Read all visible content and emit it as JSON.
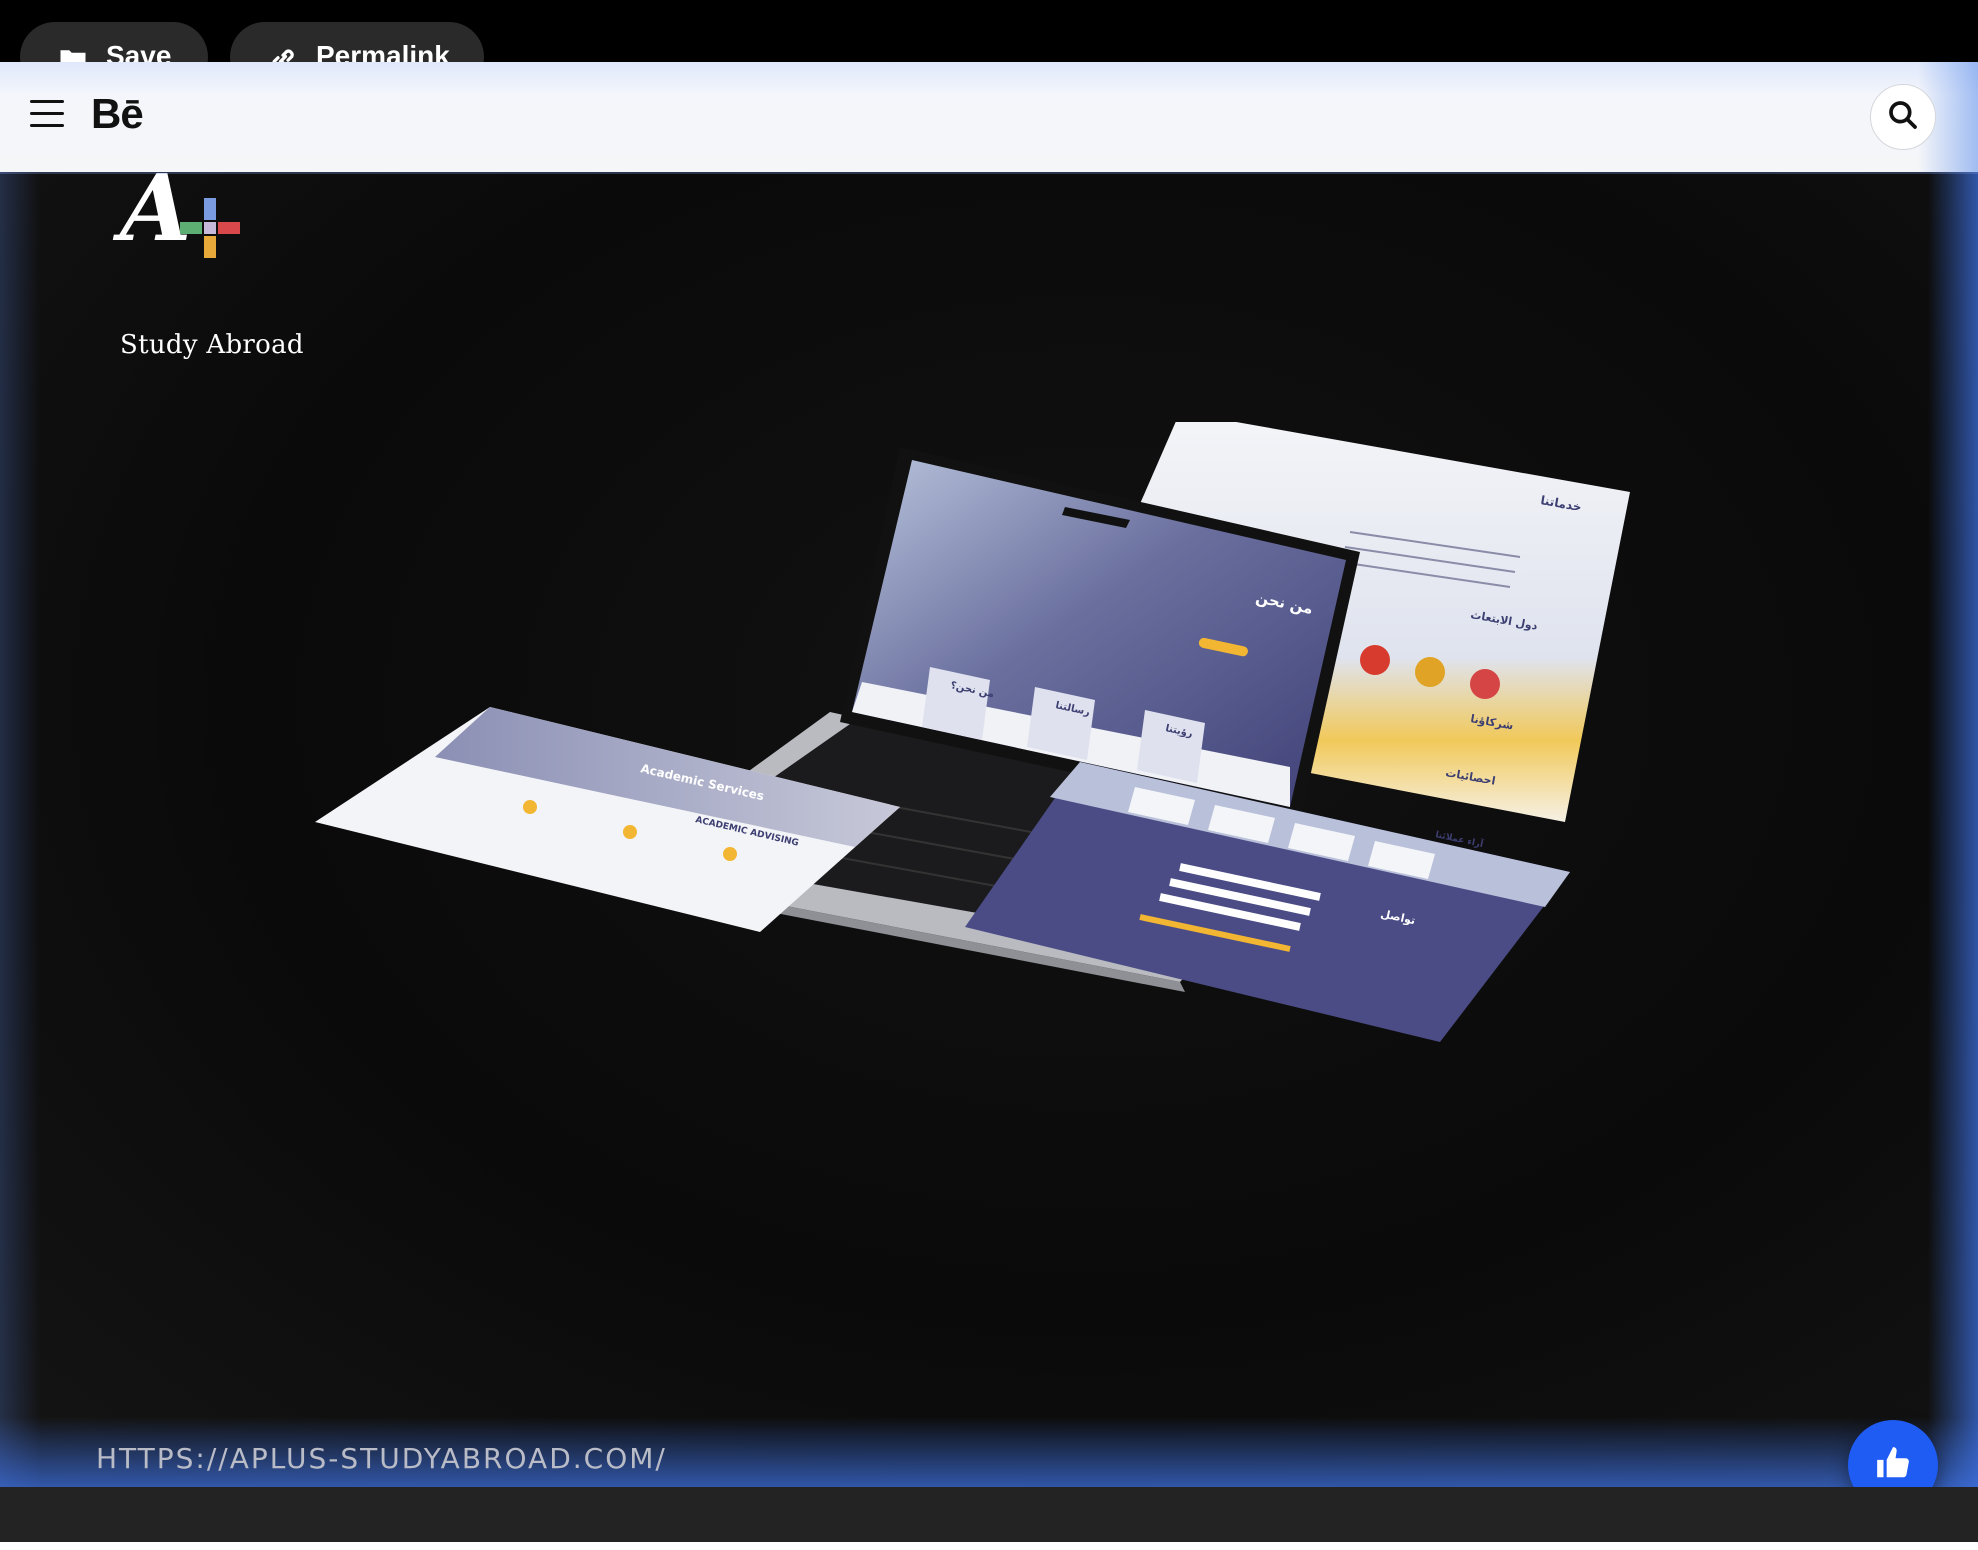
{
  "toolbar": {
    "save_label": "Save",
    "permalink_label": "Permalink",
    "save_icon": "folder-icon",
    "permalink_icon": "link-icon"
  },
  "header": {
    "brand": "Bē",
    "menu_icon": "hamburger-menu-icon",
    "search_icon": "search-icon"
  },
  "project": {
    "logo_text": "Study Abroad",
    "website_url": "HTTPS://APLUS-STUDYABROAD.COM/",
    "mockup": {
      "hero_heading": "من نحن",
      "cards": [
        "من نحن؟",
        "رسالتنا",
        "رؤيتنا"
      ],
      "services_heading": "خدماتنا",
      "countries_heading": "دول الابتعاث",
      "partners_heading": "شركاؤنا",
      "stats_heading": "احصائيات",
      "academic_services": "Academic Services",
      "academic_advising": "ACADEMIC ADVISING",
      "contact_heading": "تواصل",
      "opinions_heading": "آراء عملائنا"
    }
  },
  "actions": {
    "appreciate_icon": "thumbs-up-icon"
  },
  "colors": {
    "accent_blue": "#1f5cf4",
    "mock_purple": "#4b4c86",
    "mock_gold": "#f2b632"
  }
}
